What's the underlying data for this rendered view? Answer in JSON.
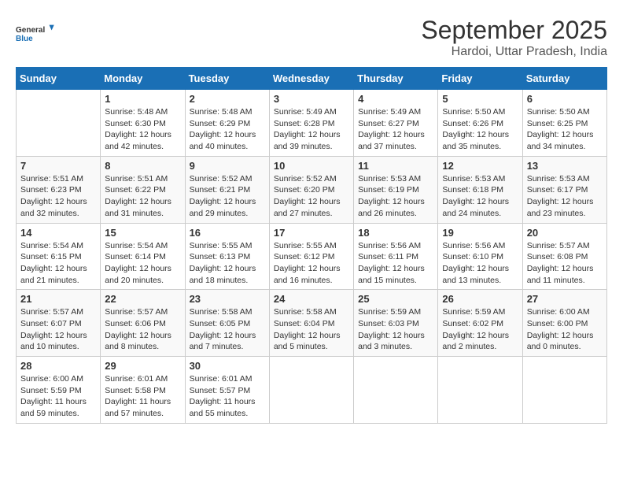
{
  "logo": {
    "general": "General",
    "blue": "Blue"
  },
  "header": {
    "month": "September 2025",
    "location": "Hardoi, Uttar Pradesh, India"
  },
  "days_of_week": [
    "Sunday",
    "Monday",
    "Tuesday",
    "Wednesday",
    "Thursday",
    "Friday",
    "Saturday"
  ],
  "weeks": [
    [
      {
        "day": "",
        "info": ""
      },
      {
        "day": "1",
        "info": "Sunrise: 5:48 AM\nSunset: 6:30 PM\nDaylight: 12 hours\nand 42 minutes."
      },
      {
        "day": "2",
        "info": "Sunrise: 5:48 AM\nSunset: 6:29 PM\nDaylight: 12 hours\nand 40 minutes."
      },
      {
        "day": "3",
        "info": "Sunrise: 5:49 AM\nSunset: 6:28 PM\nDaylight: 12 hours\nand 39 minutes."
      },
      {
        "day": "4",
        "info": "Sunrise: 5:49 AM\nSunset: 6:27 PM\nDaylight: 12 hours\nand 37 minutes."
      },
      {
        "day": "5",
        "info": "Sunrise: 5:50 AM\nSunset: 6:26 PM\nDaylight: 12 hours\nand 35 minutes."
      },
      {
        "day": "6",
        "info": "Sunrise: 5:50 AM\nSunset: 6:25 PM\nDaylight: 12 hours\nand 34 minutes."
      }
    ],
    [
      {
        "day": "7",
        "info": "Sunrise: 5:51 AM\nSunset: 6:23 PM\nDaylight: 12 hours\nand 32 minutes."
      },
      {
        "day": "8",
        "info": "Sunrise: 5:51 AM\nSunset: 6:22 PM\nDaylight: 12 hours\nand 31 minutes."
      },
      {
        "day": "9",
        "info": "Sunrise: 5:52 AM\nSunset: 6:21 PM\nDaylight: 12 hours\nand 29 minutes."
      },
      {
        "day": "10",
        "info": "Sunrise: 5:52 AM\nSunset: 6:20 PM\nDaylight: 12 hours\nand 27 minutes."
      },
      {
        "day": "11",
        "info": "Sunrise: 5:53 AM\nSunset: 6:19 PM\nDaylight: 12 hours\nand 26 minutes."
      },
      {
        "day": "12",
        "info": "Sunrise: 5:53 AM\nSunset: 6:18 PM\nDaylight: 12 hours\nand 24 minutes."
      },
      {
        "day": "13",
        "info": "Sunrise: 5:53 AM\nSunset: 6:17 PM\nDaylight: 12 hours\nand 23 minutes."
      }
    ],
    [
      {
        "day": "14",
        "info": "Sunrise: 5:54 AM\nSunset: 6:15 PM\nDaylight: 12 hours\nand 21 minutes."
      },
      {
        "day": "15",
        "info": "Sunrise: 5:54 AM\nSunset: 6:14 PM\nDaylight: 12 hours\nand 20 minutes."
      },
      {
        "day": "16",
        "info": "Sunrise: 5:55 AM\nSunset: 6:13 PM\nDaylight: 12 hours\nand 18 minutes."
      },
      {
        "day": "17",
        "info": "Sunrise: 5:55 AM\nSunset: 6:12 PM\nDaylight: 12 hours\nand 16 minutes."
      },
      {
        "day": "18",
        "info": "Sunrise: 5:56 AM\nSunset: 6:11 PM\nDaylight: 12 hours\nand 15 minutes."
      },
      {
        "day": "19",
        "info": "Sunrise: 5:56 AM\nSunset: 6:10 PM\nDaylight: 12 hours\nand 13 minutes."
      },
      {
        "day": "20",
        "info": "Sunrise: 5:57 AM\nSunset: 6:08 PM\nDaylight: 12 hours\nand 11 minutes."
      }
    ],
    [
      {
        "day": "21",
        "info": "Sunrise: 5:57 AM\nSunset: 6:07 PM\nDaylight: 12 hours\nand 10 minutes."
      },
      {
        "day": "22",
        "info": "Sunrise: 5:57 AM\nSunset: 6:06 PM\nDaylight: 12 hours\nand 8 minutes."
      },
      {
        "day": "23",
        "info": "Sunrise: 5:58 AM\nSunset: 6:05 PM\nDaylight: 12 hours\nand 7 minutes."
      },
      {
        "day": "24",
        "info": "Sunrise: 5:58 AM\nSunset: 6:04 PM\nDaylight: 12 hours\nand 5 minutes."
      },
      {
        "day": "25",
        "info": "Sunrise: 5:59 AM\nSunset: 6:03 PM\nDaylight: 12 hours\nand 3 minutes."
      },
      {
        "day": "26",
        "info": "Sunrise: 5:59 AM\nSunset: 6:02 PM\nDaylight: 12 hours\nand 2 minutes."
      },
      {
        "day": "27",
        "info": "Sunrise: 6:00 AM\nSunset: 6:00 PM\nDaylight: 12 hours\nand 0 minutes."
      }
    ],
    [
      {
        "day": "28",
        "info": "Sunrise: 6:00 AM\nSunset: 5:59 PM\nDaylight: 11 hours\nand 59 minutes."
      },
      {
        "day": "29",
        "info": "Sunrise: 6:01 AM\nSunset: 5:58 PM\nDaylight: 11 hours\nand 57 minutes."
      },
      {
        "day": "30",
        "info": "Sunrise: 6:01 AM\nSunset: 5:57 PM\nDaylight: 11 hours\nand 55 minutes."
      },
      {
        "day": "",
        "info": ""
      },
      {
        "day": "",
        "info": ""
      },
      {
        "day": "",
        "info": ""
      },
      {
        "day": "",
        "info": ""
      }
    ]
  ]
}
